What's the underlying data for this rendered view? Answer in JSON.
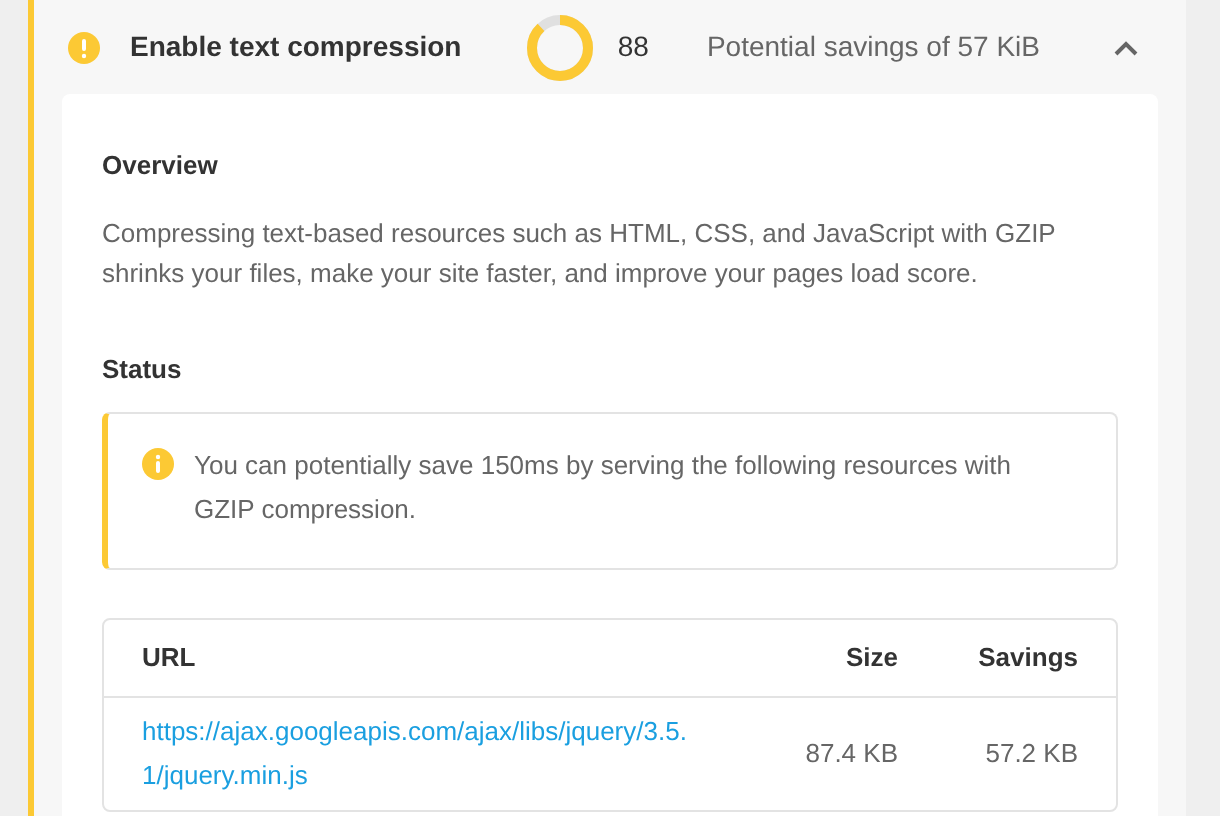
{
  "audit": {
    "title": "Enable text compression",
    "expanded": true,
    "score": {
      "value": "88"
    },
    "savings": "Potential savings of 57 KiB"
  },
  "overview": {
    "heading": "Overview",
    "text": "Compressing text-based resources such as HTML, CSS, and JavaScript with GZIP shrinks your files, make your site faster, and improve your pages load score."
  },
  "status": {
    "heading": "Status",
    "alert": "You can potentially save 150ms by serving the following resources with GZIP compression."
  },
  "table": {
    "columns": [
      "URL",
      "Size",
      "Savings"
    ],
    "rows": [
      {
        "url": "https://ajax.googleapis.com/ajax/libs/jquery/3.5.1/jquery.min.js",
        "size": "87.4 KB",
        "savings": "57.2 KB"
      }
    ]
  }
}
